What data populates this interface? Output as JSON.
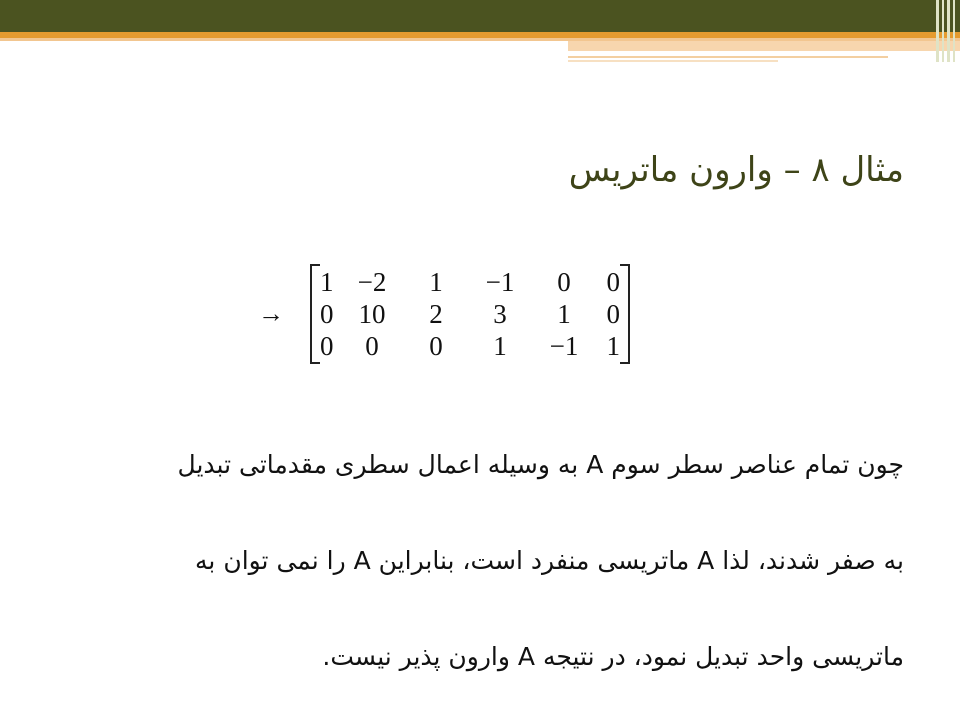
{
  "slide": {
    "title": "مثال ۸ – وارون ماتریس",
    "arrow": "→",
    "matrix": [
      [
        "1",
        "−2",
        "1",
        "−1",
        "0",
        "0"
      ],
      [
        "0",
        "10",
        "2",
        "3",
        "1",
        "0"
      ],
      [
        "0",
        "0",
        "0",
        "1",
        "−1",
        "1"
      ]
    ],
    "paragraph_lines": [
      "چون تمام عناصر سطر سوم A به وسیله اعمال سطری مقدماتی تبدیل",
      "به صفر شدند، لذا A ماتریسی منفرد است، بنابراین A را نمی توان به",
      "ماتریسی واحد تبدیل نمود، در نتیجه A وارون پذیر نیست."
    ]
  },
  "colors": {
    "header_dark": "#4b5320",
    "header_orange": "#e59b2f",
    "title_text": "#3e4418"
  }
}
